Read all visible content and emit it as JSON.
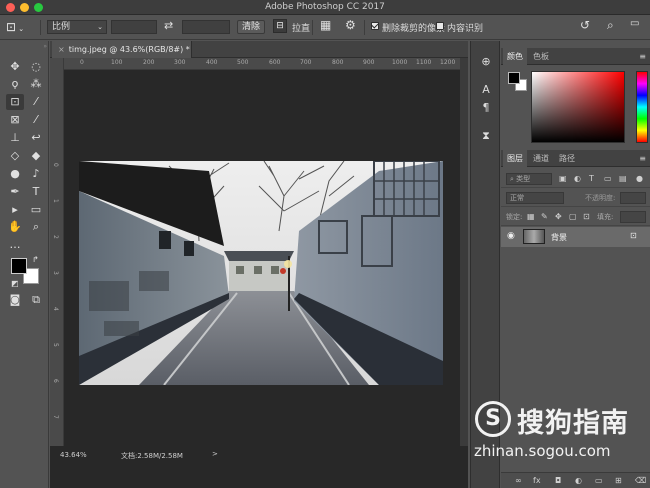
{
  "window": {
    "title": "Adobe Photoshop CC 2017"
  },
  "options_bar": {
    "tool_icon": "crop-icon",
    "ratio_select_value": "比例",
    "clear_button": "清除",
    "straighten_label": "拉直",
    "delete_cropped_pixels_label": "删除裁剪的像素",
    "delete_cropped_pixels_checked": true,
    "content_aware_label": "内容识别",
    "content_aware_checked": false
  },
  "document": {
    "tab_title": "timg.jpeg @ 43.6%(RGB/8#) *",
    "ruler_top_ticks": [
      "0",
      "100",
      "200",
      "300",
      "400",
      "500",
      "600",
      "700",
      "800",
      "900",
      "1000",
      "1100",
      "1200"
    ],
    "ruler_left_ticks": [
      "0",
      "1",
      "2",
      "3",
      "4",
      "5",
      "6",
      "7"
    ]
  },
  "status_bar": {
    "zoom": "43.64%",
    "doc_size": "文档:2.58M/2.58M",
    "arrow": ">"
  },
  "color_panel": {
    "tabs": [
      "颜色",
      "色板"
    ],
    "foreground": "#000000",
    "background": "#ffffff"
  },
  "layers_panel": {
    "tabs": [
      "图层",
      "通道",
      "路径"
    ],
    "filter_select": "类型",
    "blend_mode": "正常",
    "opacity_label": "不透明度:",
    "lock_label": "锁定:",
    "fill_label": "填充:",
    "layers": [
      {
        "name": "背景",
        "visible": true,
        "locked": true
      }
    ]
  },
  "watermark": {
    "logo_letter": "S",
    "title": "搜狗指南",
    "url": "zhinan.sogou.com"
  }
}
